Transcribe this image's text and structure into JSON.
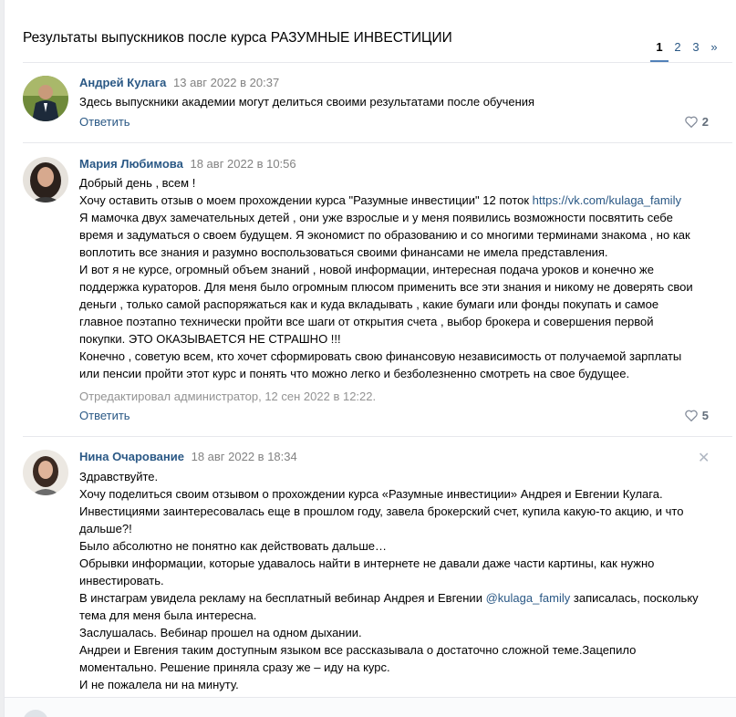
{
  "topic": {
    "title": "Результаты выпускников после курса РАЗУМНЫЕ ИНВЕСТИЦИИ",
    "pages": [
      "1",
      "2",
      "3",
      "»"
    ],
    "current_page": "1"
  },
  "posts": [
    {
      "author": "Андрей Кулага",
      "date": "13 авг 2022 в 20:37",
      "lines": [
        "Здесь выпускники академии могут делиться своими результатами после обучения"
      ],
      "reply_label": "Ответить",
      "likes": "2"
    },
    {
      "author": "Мария Любимова",
      "date": "18 авг 2022 в 10:56",
      "lines": [
        "Добрый день , всем !",
        "Хочу оставить отзыв о моем прохождении курса \"Разумные инвестиции\" 12 поток ",
        "Я мамочка двух замечательных детей , они уже взрослые и у меня появились возможности посвятить себе",
        "время и задуматься о своем будущем. Я экономист по образованию и со многими терминами знакома , но как",
        "воплотить все знания и разумно воспользоваться своими финансами не имела представления.",
        "И вот я не курсе, огромный объем знаний , новой информации, интересная подача уроков и конечно же",
        "поддержка кураторов. Для меня было огромным плюсом применить все эти знания и никому не доверять свои",
        "деньги , только самой распоряжаться как и куда вкладывать , какие бумаги или фонды покупать и самое",
        "главное поэтапно технически пройти все шаги от открытия счета , выбор брокера и совершения первой",
        "покупки. ЭТО ОКАЗЫВАЕТСЯ НЕ СТРАШНО !!!",
        "Конечно , советую всем, кто хочет сформировать свою финансовую независимость от получаемой зарплаты",
        "или пенсии пройти этот курс и понять что можно легко и безболезненно смотреть на свое будущее."
      ],
      "link": "https://vk.com/kulaga_family",
      "edited": "Отредактировал администратор, 12 сен 2022 в 12:22.",
      "reply_label": "Ответить",
      "likes": "5"
    },
    {
      "author": "Нина Очарование",
      "date": "18 авг 2022 в 18:34",
      "lines": [
        "Здравствуйте.",
        "Хочу поделиться своим отзывом о прохождении курса «Разумные инвестиции» Андрея и Евгении Кулага.",
        "Инвестициями заинтересовалась еще в прошлом году, завела брокерский счет, купила какую-то акцию, и что",
        "дальше?!",
        "Было абсолютно не понятно как действовать дальше…",
        "Обрывки информации, которые удавалось найти в интернете не давали даже части картины, как нужно",
        "инвестировать.",
        "В инстаграм увидела рекламу на бесплатный вебинар Андрея и Евгении ",
        "тема для меня была интересна.",
        "Заслушалась. Вебинар прошел на одном дыхании.",
        "Андреи и Евгения таким доступным языком все рассказывала о достаточно сложной теме.Зацепило",
        "моментально. Решение приняла сразу же – иду на курс.",
        "И не пожалела ни на минуту."
      ],
      "mention": "@kulaga_family",
      "mention_after": " записалась, поскольку",
      "close_glyph": "✕"
    }
  ],
  "colors": {
    "link": "#2a5885",
    "muted": "#828282",
    "accent": "#5181b8"
  }
}
